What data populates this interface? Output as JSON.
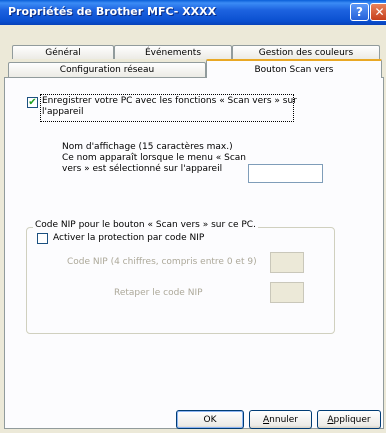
{
  "window": {
    "title": "Propriétés de Brother MFC- XXXX",
    "help_glyph": "?",
    "close_glyph": "✕"
  },
  "tabs": {
    "row_back": [
      "Général",
      "Événements",
      "Gestion des couleurs"
    ],
    "row_front": [
      "Configuration réseau",
      "Bouton Scan vers"
    ],
    "active": "Bouton Scan vers"
  },
  "scan_to": {
    "register_checked": true,
    "register_label_line1": "Enregistrer votre PC avec les fonctions « Scan vers » sur",
    "register_label_line2": "l'appareil",
    "display_name_lines": [
      "Nom d'affichage (15 caractères max.)",
      "Ce nom apparaît lorsque le menu « Scan",
      "vers » est sélectionné sur l'appareil"
    ],
    "display_name_value": ""
  },
  "pin_group": {
    "legend": "Code NIP pour le bouton « Scan vers » sur ce PC.",
    "protect_checked": false,
    "protect_label": "Activer la protection par code NIP",
    "pin_label": "Code NIP (4 chiffres, compris entre 0 et 9)",
    "pin_value": "",
    "retype_label": "Retaper le code NIP",
    "retype_value": ""
  },
  "buttons": {
    "ok": "OK",
    "cancel_u": "A",
    "cancel_rest": "nnuler",
    "apply_u": "A",
    "apply_rest": "ppliquer"
  },
  "colors": {
    "titlebar": "#0a4fd0",
    "dialog_bg": "#ece9d8",
    "panel_bg": "#fcfcfe",
    "active_tab_accent": "#e9a825",
    "checkmark": "#21a121"
  }
}
